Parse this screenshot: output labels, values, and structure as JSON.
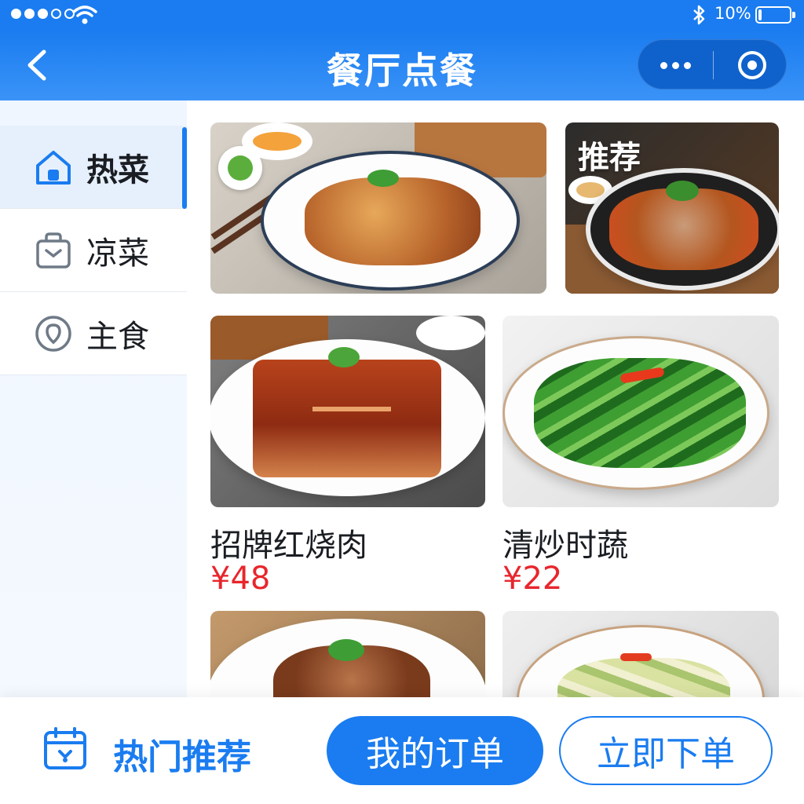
{
  "status_bar": {
    "battery_text": "10%",
    "battery_level": 0.1,
    "signal_filled": 3,
    "signal_total": 5,
    "icons": [
      "signal-icon",
      "wifi-icon",
      "bluetooth-icon",
      "battery-icon"
    ]
  },
  "nav": {
    "title": "餐厅点餐",
    "icons": [
      "back-icon",
      "more-icon",
      "close-icon"
    ]
  },
  "sidebar": {
    "items": [
      {
        "label": "热菜",
        "icon": "home-icon",
        "active": true
      },
      {
        "label": "凉菜",
        "icon": "bag-icon",
        "active": false
      },
      {
        "label": "主食",
        "icon": "location-icon",
        "active": false
      }
    ]
  },
  "banner": {
    "recommend_tag": "推荐"
  },
  "dishes": [
    {
      "name": "招牌红烧肉",
      "price": "¥48"
    },
    {
      "name": "清炒时蔬",
      "price": "¥22"
    }
  ],
  "bottom": {
    "hot_label": "热门推荐",
    "hot_icon": "calendar-icon",
    "my_orders": "我的订单",
    "order_now": "立即下单"
  },
  "colors": {
    "primary": "#1a7cf0",
    "price": "#e8262c",
    "text": "#1a1d22"
  }
}
